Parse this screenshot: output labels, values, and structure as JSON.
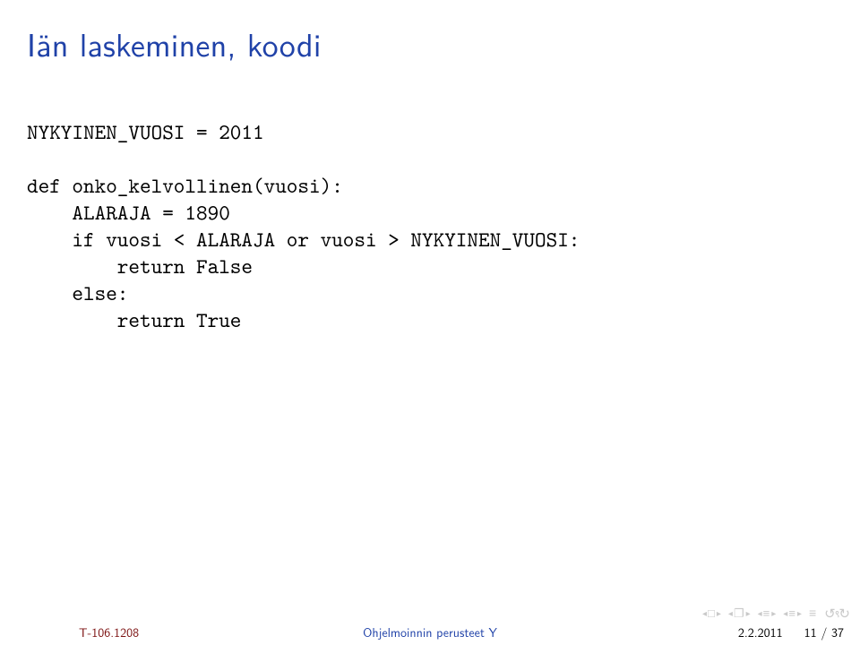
{
  "title": "Iän laskeminen, koodi",
  "code": {
    "l1": "NYKYINEN_VUOSI = 2011",
    "l2": "",
    "l3": "def onko_kelvollinen(vuosi):",
    "l4": "    ALARAJA = 1890",
    "l5": "    if vuosi < ALARAJA or vuosi > NYKYINEN_VUOSI:",
    "l6": "        return False",
    "l7": "    else:",
    "l8": "        return True"
  },
  "footer": {
    "course_code": "T-106.1208",
    "course_title": "Ohjelmoinnin perusteet Y",
    "date": "2.2.2011",
    "page": "11 / 37"
  },
  "nav": {
    "back_slide": "◂",
    "fwd_slide": "▸",
    "section": "❐",
    "subsec_l": "≡",
    "subsec_r": "≡",
    "eq": "≡",
    "loop": "↺ ∾ ↻"
  }
}
